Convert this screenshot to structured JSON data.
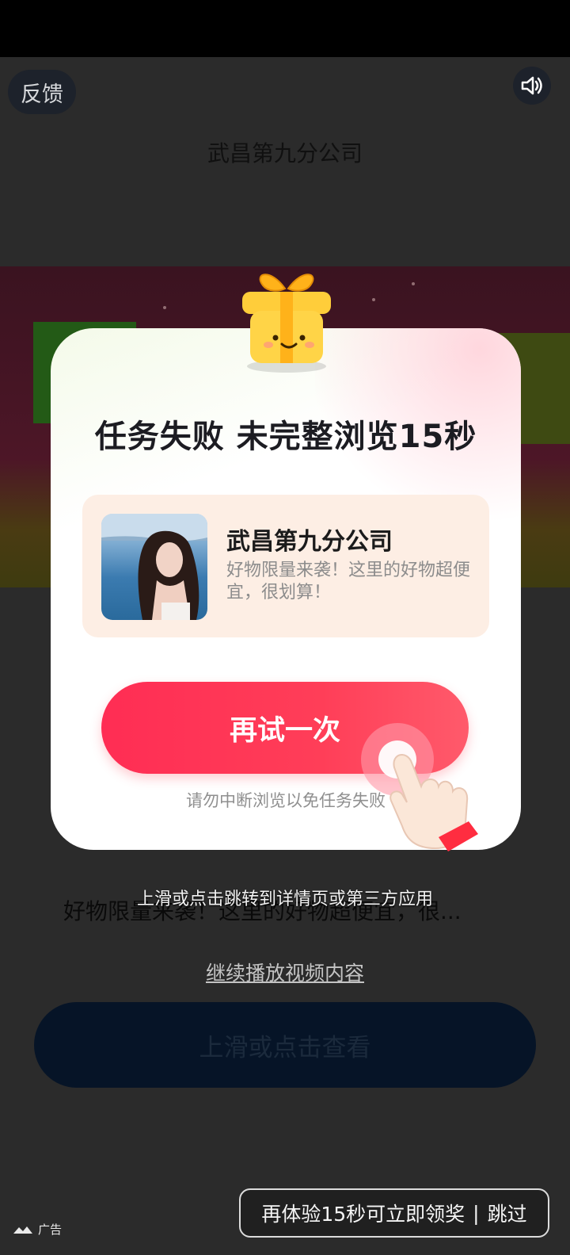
{
  "top": {
    "feedback_label": "反馈",
    "sound_icon": "speaker-icon"
  },
  "background": {
    "title": "武昌第九分公司",
    "description": "好物限量来袭！这里的好物超便宜，很...",
    "overlay_hint": "上滑或点击跳转到详情页或第三方应用",
    "continue_label": "继续播放视频内容",
    "cta_label": "上滑或点击查看"
  },
  "modal": {
    "title": "任务失败 未完整浏览15秒",
    "card": {
      "name": "武昌第九分公司",
      "description": "好物限量来袭！这里的好物超便宜，很划算！"
    },
    "retry_label": "再试一次",
    "tip": "请勿中断浏览以免任务失败",
    "gift_icon": "gift-icon",
    "hand_icon": "pointing-hand-icon"
  },
  "footer": {
    "ad_label": "广告",
    "skip_text": "再体验15秒可立即领奖",
    "skip_separator": "|",
    "skip_label": "跳过"
  },
  "colors": {
    "accent": "#ff2d54",
    "card_bg": "#fdeee4",
    "cta_bg": "#061427"
  }
}
